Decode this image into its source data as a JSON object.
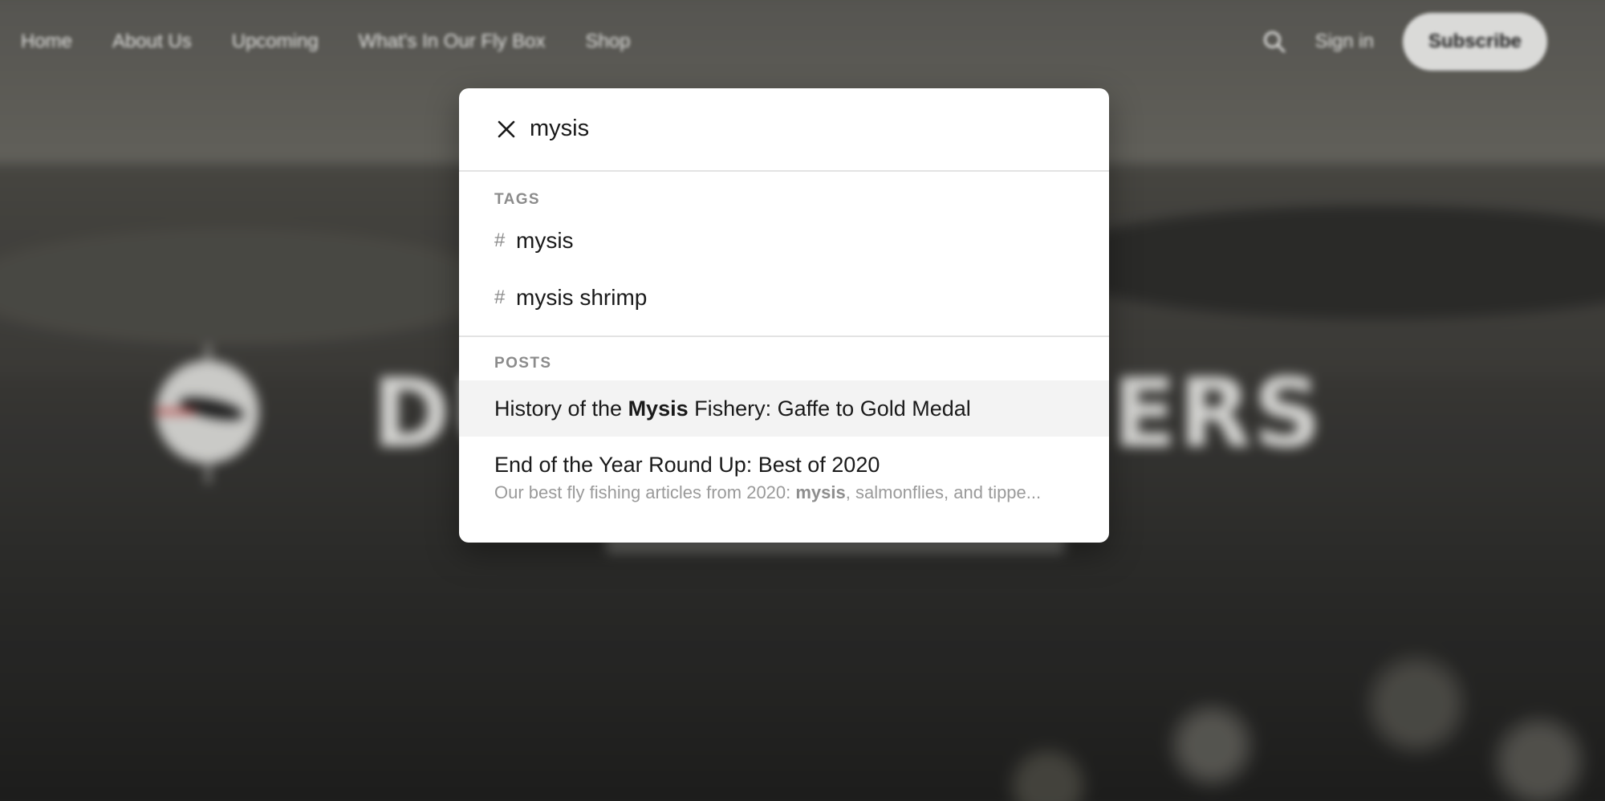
{
  "nav": {
    "items": [
      "Home",
      "About Us",
      "Upcoming",
      "What's In Our Fly Box",
      "Shop"
    ],
    "signin_label": "Sign in",
    "subscribe_label": "Subscribe",
    "search_icon": "search-icon"
  },
  "hero": {
    "logo_left": "DU",
    "logo_right": "ERS",
    "logo_icon": "compass-badge-icon"
  },
  "search": {
    "query": "mysis",
    "close_icon": "close-icon",
    "tags_heading": "TAGS",
    "tags": [
      {
        "hash": "#",
        "label": "mysis"
      },
      {
        "hash": "#",
        "label": "mysis shrimp"
      }
    ],
    "posts_heading": "POSTS",
    "posts": [
      {
        "title_before": "History of the ",
        "title_match": "Mysis",
        "title_after": " Fishery: Gaffe to Gold Medal"
      },
      {
        "title": "End of the Year Round Up: Best of 2020",
        "excerpt_before": "Our best fly fishing articles from 2020: ",
        "excerpt_match": "mysis",
        "excerpt_after": ", salmonflies, and tippe..."
      }
    ]
  },
  "colors": {
    "modal_bg": "#ffffff",
    "active_row_bg": "#f3f3f3",
    "muted_text": "#8b8b8b",
    "subscribe_bg": "#ebebe9"
  }
}
